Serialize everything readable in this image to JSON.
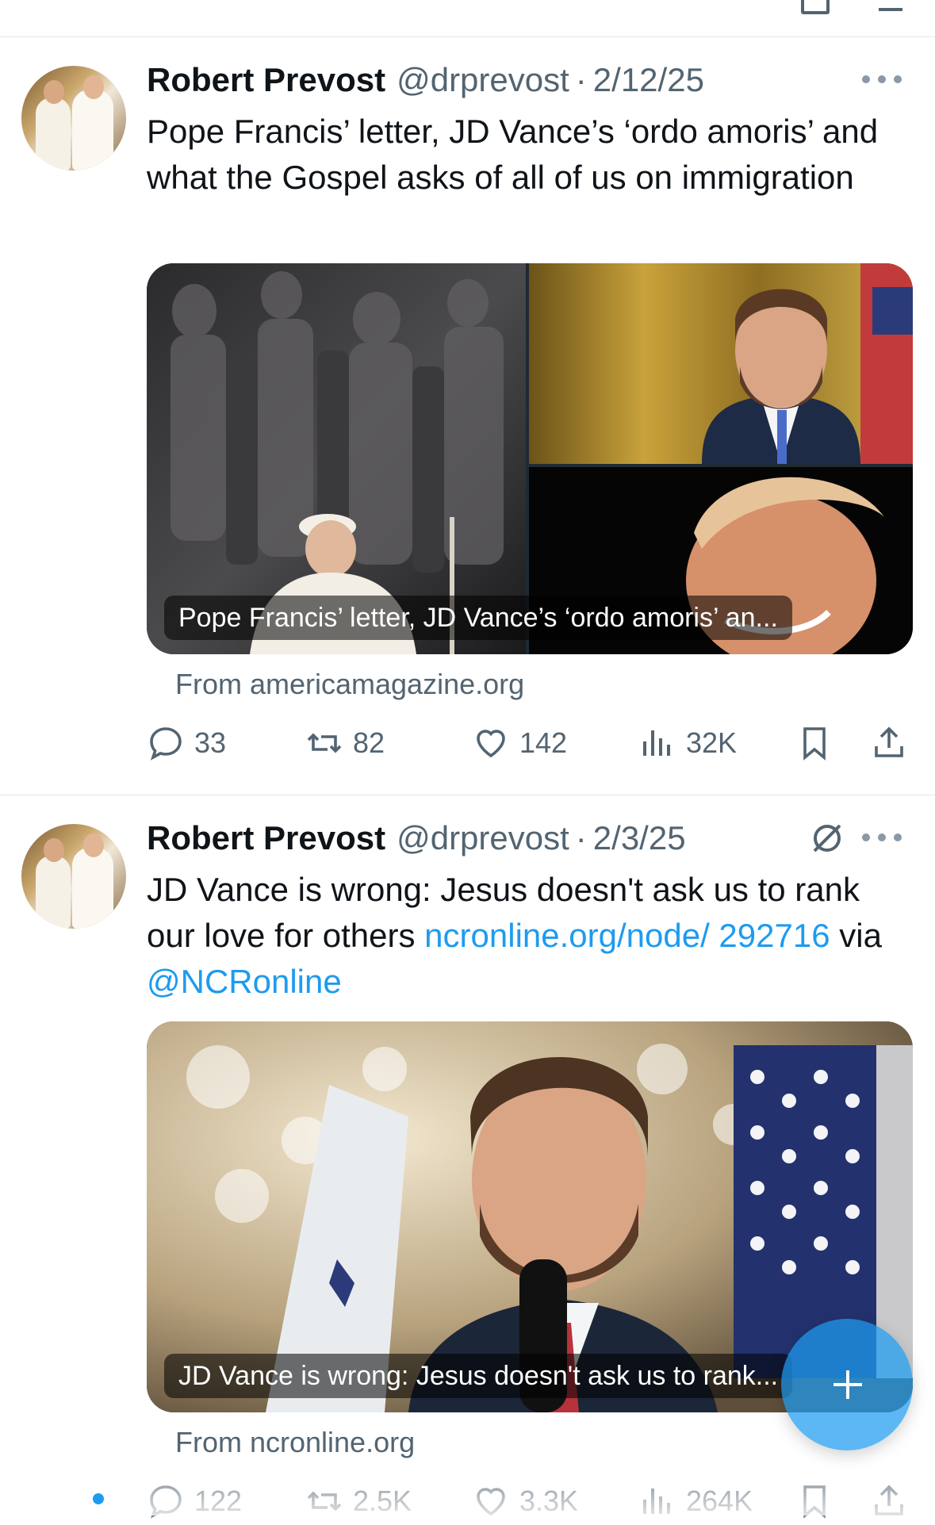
{
  "theme": {
    "accent": "#1d9bf0",
    "text": "#0f1419",
    "muted": "#536471",
    "divider": "#e3e6e9"
  },
  "tweets": [
    {
      "author_name": "Robert Prevost",
      "handle": "@drprevost",
      "separator": "·",
      "date": "2/12/25",
      "text": "Pope Francis’ letter, JD Vance’s ‘ordo amoris’ and what the Gospel asks of all of us on immigration",
      "card_caption": "Pope Francis’ letter, JD Vance’s ‘ordo amoris’ an...",
      "source": "From americamagazine.org",
      "replies": "33",
      "reposts": "82",
      "likes": "142",
      "views": "32K",
      "icons": [
        "reply-icon",
        "repost-icon",
        "like-icon",
        "views-icon",
        "bookmark-icon",
        "share-icon",
        "more-icon"
      ]
    },
    {
      "author_name": "Robert Prevost",
      "handle": "@drprevost",
      "separator": "·",
      "date": "2/3/25",
      "text_plain_1": "JD Vance is wrong: Jesus doesn't ask us to rank our love for others ",
      "text_link": "ncronline.org/node/ 292716",
      "text_plain_2": " via ",
      "text_mention": "@NCRonline",
      "card_caption": "JD Vance is wrong: Jesus doesn't ask us to rank...",
      "source": "From ncronline.org",
      "replies": "122",
      "reposts": "2.5K",
      "likes": "3.3K",
      "views": "264K",
      "icons": [
        "grok-icon",
        "more-icon",
        "reply-icon",
        "repost-icon",
        "like-icon",
        "views-icon",
        "bookmark-icon",
        "share-icon"
      ]
    }
  ],
  "fab": {
    "icon": "plus-icon"
  }
}
